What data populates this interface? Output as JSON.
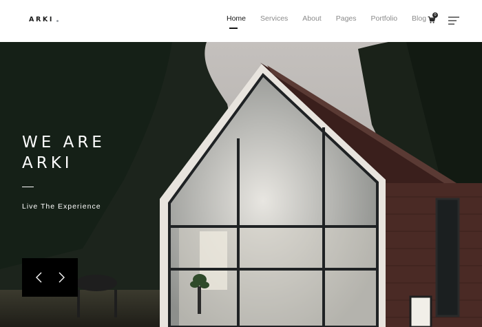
{
  "header": {
    "logo": "ARKI",
    "nav": [
      {
        "label": "Home",
        "active": true
      },
      {
        "label": "Services",
        "active": false
      },
      {
        "label": "About",
        "active": false
      },
      {
        "label": "Pages",
        "active": false
      },
      {
        "label": "Portfolio",
        "active": false
      },
      {
        "label": "Blog",
        "active": false
      }
    ],
    "cart_count": "0",
    "icons": [
      "cart-icon",
      "menu-icon"
    ]
  },
  "hero": {
    "title_line1": "WE ARE",
    "title_line2": "ARKI",
    "subtitle": "Live The Experience",
    "controls": [
      "chevron-left-icon",
      "chevron-right-icon"
    ]
  },
  "colors": {
    "text_dark": "#151515",
    "nav_muted": "#8a8a8a",
    "slider_bg": "#000000"
  }
}
